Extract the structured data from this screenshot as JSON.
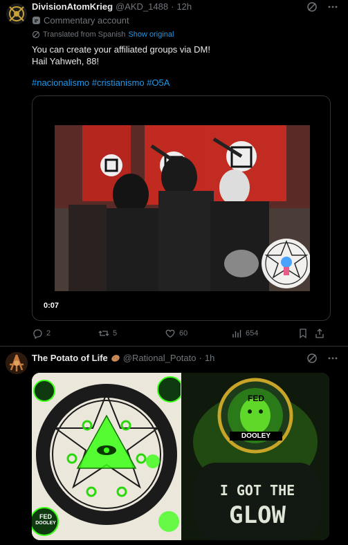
{
  "tweet1": {
    "display_name": "DivisionAtomKrieg",
    "handle": "@AKD_1488",
    "dot": "·",
    "time": "12h",
    "commentary_label": "Commentary account",
    "translated_label": "Translated from Spanish",
    "show_original": "Show original",
    "text_line1": "You can create your affiliated groups via DM!",
    "text_line2": "Hail Yahweh, 88!",
    "hashtags": "#nacionalismo #cristianismo #O5A",
    "video_duration": "0:07",
    "replies": "2",
    "reposts": "5",
    "likes": "60",
    "views": "654"
  },
  "tweet2": {
    "display_name": "The Potato of Life",
    "handle": "@Rational_Potato",
    "dot": "·",
    "time": "1h",
    "right_panel": {
      "seal_top": "FED",
      "seal_bottom": "DOOLEY",
      "shirt_line1": "I GOT THE",
      "shirt_line2": "GLOW"
    },
    "left_panel_badge_top": "FED",
    "left_panel_badge_bottom": "DOOLEY"
  },
  "colors": {
    "background": "#000000",
    "text": "#e7e9ea",
    "muted": "#71767b",
    "link": "#1d9bf0",
    "border": "#2f3336",
    "glow_green": "#39ff14"
  },
  "icons": [
    "grok-icon",
    "more-icon",
    "commentary-badge-icon",
    "translate-icon",
    "reply-icon",
    "repost-icon",
    "like-icon",
    "views-icon",
    "bookmark-icon",
    "share-icon",
    "potato-emoji-icon"
  ]
}
